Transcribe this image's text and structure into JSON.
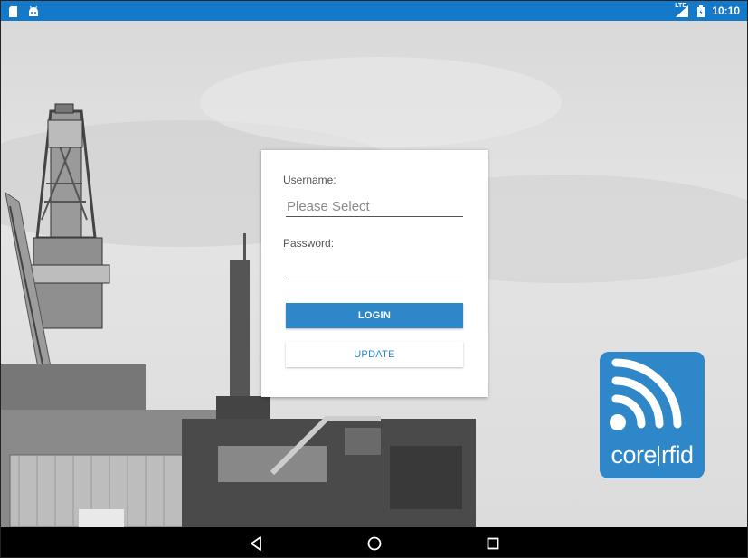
{
  "status_bar": {
    "time": "10:10",
    "network": "LTE",
    "left_icons": [
      "sd-card-icon",
      "android-icon"
    ],
    "right_icons": [
      "signal-icon",
      "battery-icon"
    ],
    "color": "#1479c9"
  },
  "login": {
    "username_label": "Username:",
    "username_placeholder": "Please Select",
    "username_value": "",
    "password_label": "Password:",
    "password_value": "",
    "login_button": "LOGIN",
    "update_button": "UPDATE",
    "accent": "#2e87c8"
  },
  "logo": {
    "text_left": "core",
    "text_right": "rfid",
    "icon": "rfid-signal-icon"
  },
  "nav_bar": {
    "buttons": [
      "back-icon",
      "home-icon",
      "recents-icon"
    ]
  }
}
